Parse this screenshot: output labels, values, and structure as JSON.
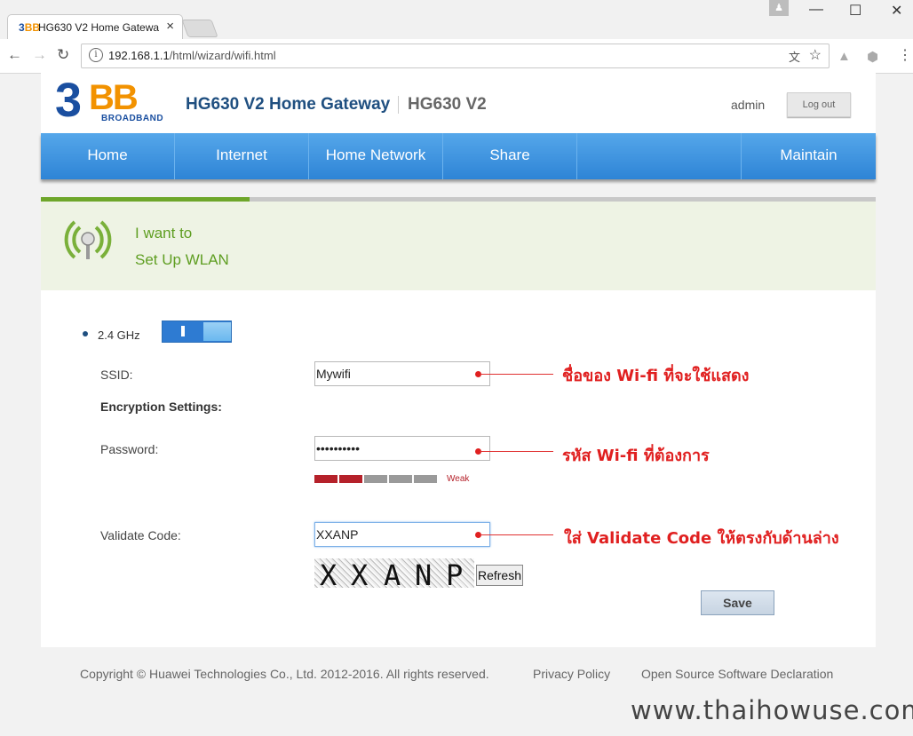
{
  "browser": {
    "tab_title": "HG630 V2 Home Gatewa",
    "tab_close": "×",
    "url_host": "192.168.1.1",
    "url_path": "/html/wizard/wifi.html",
    "window_buttons": [
      "—",
      "☐",
      "✕"
    ]
  },
  "header": {
    "logo_number": "3",
    "logo_letters": "BB",
    "logo_sub": "BROADBAND",
    "product": "HG630 V2 Home Gateway",
    "model": "HG630 V2",
    "user": "admin",
    "logout_label": "Log out"
  },
  "nav": {
    "items": [
      {
        "label": "Home"
      },
      {
        "label": "Internet"
      },
      {
        "label": "Home Network"
      },
      {
        "label": "Share"
      },
      {
        "label": ""
      },
      {
        "label": "Maintain"
      }
    ]
  },
  "wizard": {
    "progress_fraction": 0.25,
    "line1": "I want to",
    "line2": "Set Up WLAN"
  },
  "form": {
    "band": "2.4 GHz",
    "band_enabled": true,
    "ssid_label": "SSID:",
    "ssid_value": "Mywifi",
    "encryption_heading": "Encryption Settings:",
    "password_label": "Password:",
    "password_value": "••••••••••",
    "strength_label": "Weak",
    "strength_segments": 2,
    "strength_total": 5,
    "validate_label": "Validate Code:",
    "validate_value": "XXANP",
    "captcha_chars": [
      "X",
      "X",
      "A",
      "N",
      "P"
    ],
    "refresh_label": "Refresh",
    "save_label": "Save"
  },
  "annotations": {
    "ssid": "ชื่อของ Wi-fi ที่จะใช้แสดง",
    "password": "รหัส Wi-fi ที่ต้องการ",
    "validate": "ใส่ Validate Code ให้ตรงกับด้านล่าง"
  },
  "footer": {
    "copyright": "Copyright © Huawei Technologies Co., Ltd. 2012-2016. All rights reserved.",
    "privacy": "Privacy Policy",
    "oss": "Open Source Software Declaration"
  },
  "watermark": "www.thaihowuse.com",
  "colors": {
    "nav_blue": "#2e84d6",
    "accent_green": "#5f9e22",
    "annotation_red": "#e02020",
    "weak_red": "#b5212a"
  }
}
